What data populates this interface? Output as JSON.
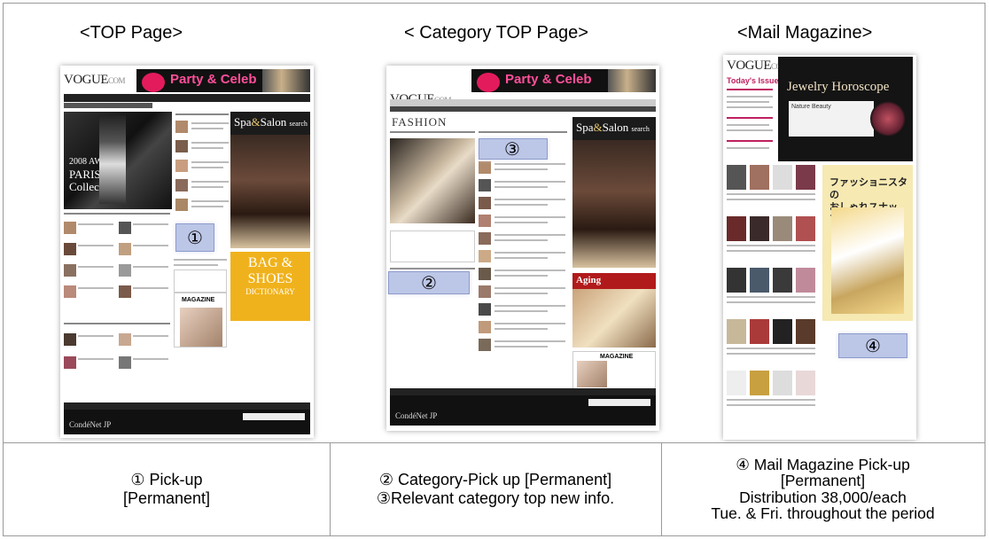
{
  "sections": {
    "top_page": {
      "title": "<TOP Page>"
    },
    "category_top": {
      "title": "< Category TOP Page>"
    },
    "mail_magazine": {
      "title": "<Mail Magazine>"
    }
  },
  "markers": {
    "m1": "①",
    "m2": "②",
    "m3": "③",
    "m4": "④"
  },
  "mockups": {
    "logo": "VOGUE",
    "logo_suffix": "COM",
    "banner": "Party & Celeb",
    "spa": "Spa",
    "spa_and": "&",
    "spa_salon": "Salon",
    "spa_search": "search",
    "hero_year": "2008 AW",
    "hero_city": "PARIS",
    "hero_word": "Collection",
    "bag_line1": "BAG &",
    "bag_line2": "SHOES",
    "bag_line3": "DICTIONARY",
    "magazine": "MAGAZINE",
    "fashion": "FASHION",
    "aging": "Aging",
    "todays_issue": "Today's Issue",
    "jewelry": "Jewelry Horoscope",
    "nature_beauty": "Nature Beauty",
    "snap_line1": "ファッショニスタの",
    "snap_line2": "おしゃれスナップ。",
    "condenet": "CondéNet JP"
  },
  "table": {
    "col1": {
      "line1": "① Pick-up",
      "line2": "[Permanent]"
    },
    "col2": {
      "line1": "② Category-Pick up [Permanent]",
      "line2": "③Relevant category top new info."
    },
    "col3": {
      "line1": "④ Mail Magazine Pick-up",
      "line2": "[Permanent]",
      "line3": "Distribution 38,000/each",
      "line4": "Tue. & Fri. throughout the period"
    }
  }
}
